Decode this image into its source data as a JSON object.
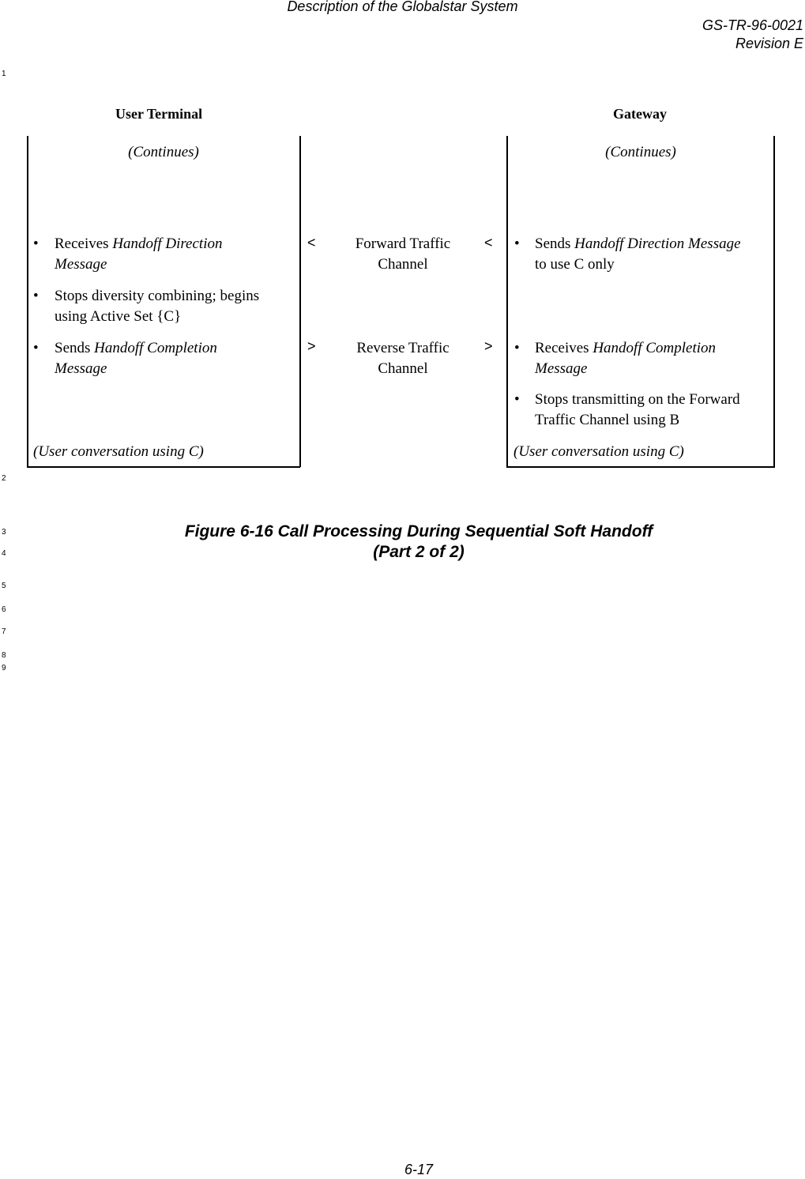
{
  "header": {
    "title": "Description of the Globalstar System",
    "doc_number": "GS-TR-96-0021",
    "revision": "Revision E"
  },
  "line_numbers": [
    "1",
    "2",
    "3",
    "4",
    "5",
    "6",
    "7",
    "8",
    "9"
  ],
  "figure": {
    "columns": {
      "left": "User Terminal",
      "right": "Gateway"
    },
    "user_terminal": {
      "continues": "(Continues)",
      "items": [
        {
          "bullet": "•",
          "plain": "Receives ",
          "italic": "Handoff Direction",
          "line2_italic": "Message",
          "line2_plain": ""
        },
        {
          "bullet": "•",
          "plain": "Stops diversity combining; begins",
          "italic": "",
          "line2_italic": "",
          "line2_plain": "using Active Set {C}"
        },
        {
          "bullet": "•",
          "plain": "Sends ",
          "italic": "Handoff Completion",
          "line2_italic": "Message",
          "line2_plain": ""
        }
      ],
      "conversation": "(User conversation using C)"
    },
    "channels": [
      {
        "left_arrow": "<",
        "right_arrow": "<",
        "line1": "Forward Traffic",
        "line2": "Channel"
      },
      {
        "left_arrow": ">",
        "right_arrow": ">",
        "line1": "Reverse Traffic",
        "line2": "Channel"
      }
    ],
    "gateway": {
      "continues": "(Continues)",
      "items": [
        {
          "bullet": "•",
          "plain": "Sends ",
          "italic": "Handoff Direction Message",
          "line2_plain": "to use C only",
          "line2_italic": ""
        },
        {
          "bullet": "•",
          "plain": "Receives ",
          "italic": "Handoff Completion",
          "line2_plain": "",
          "line2_italic": "Message"
        },
        {
          "bullet": "•",
          "plain": "Stops transmitting on the Forward",
          "italic": "",
          "line2_plain": "Traffic Channel using B",
          "line2_italic": ""
        }
      ],
      "conversation": "(User conversation using C)"
    },
    "caption_line1": "Figure 6-16 Call Processing During Sequential Soft Handoff",
    "caption_line2": "(Part 2 of 2)"
  },
  "footer": {
    "page_number": "6-17"
  }
}
